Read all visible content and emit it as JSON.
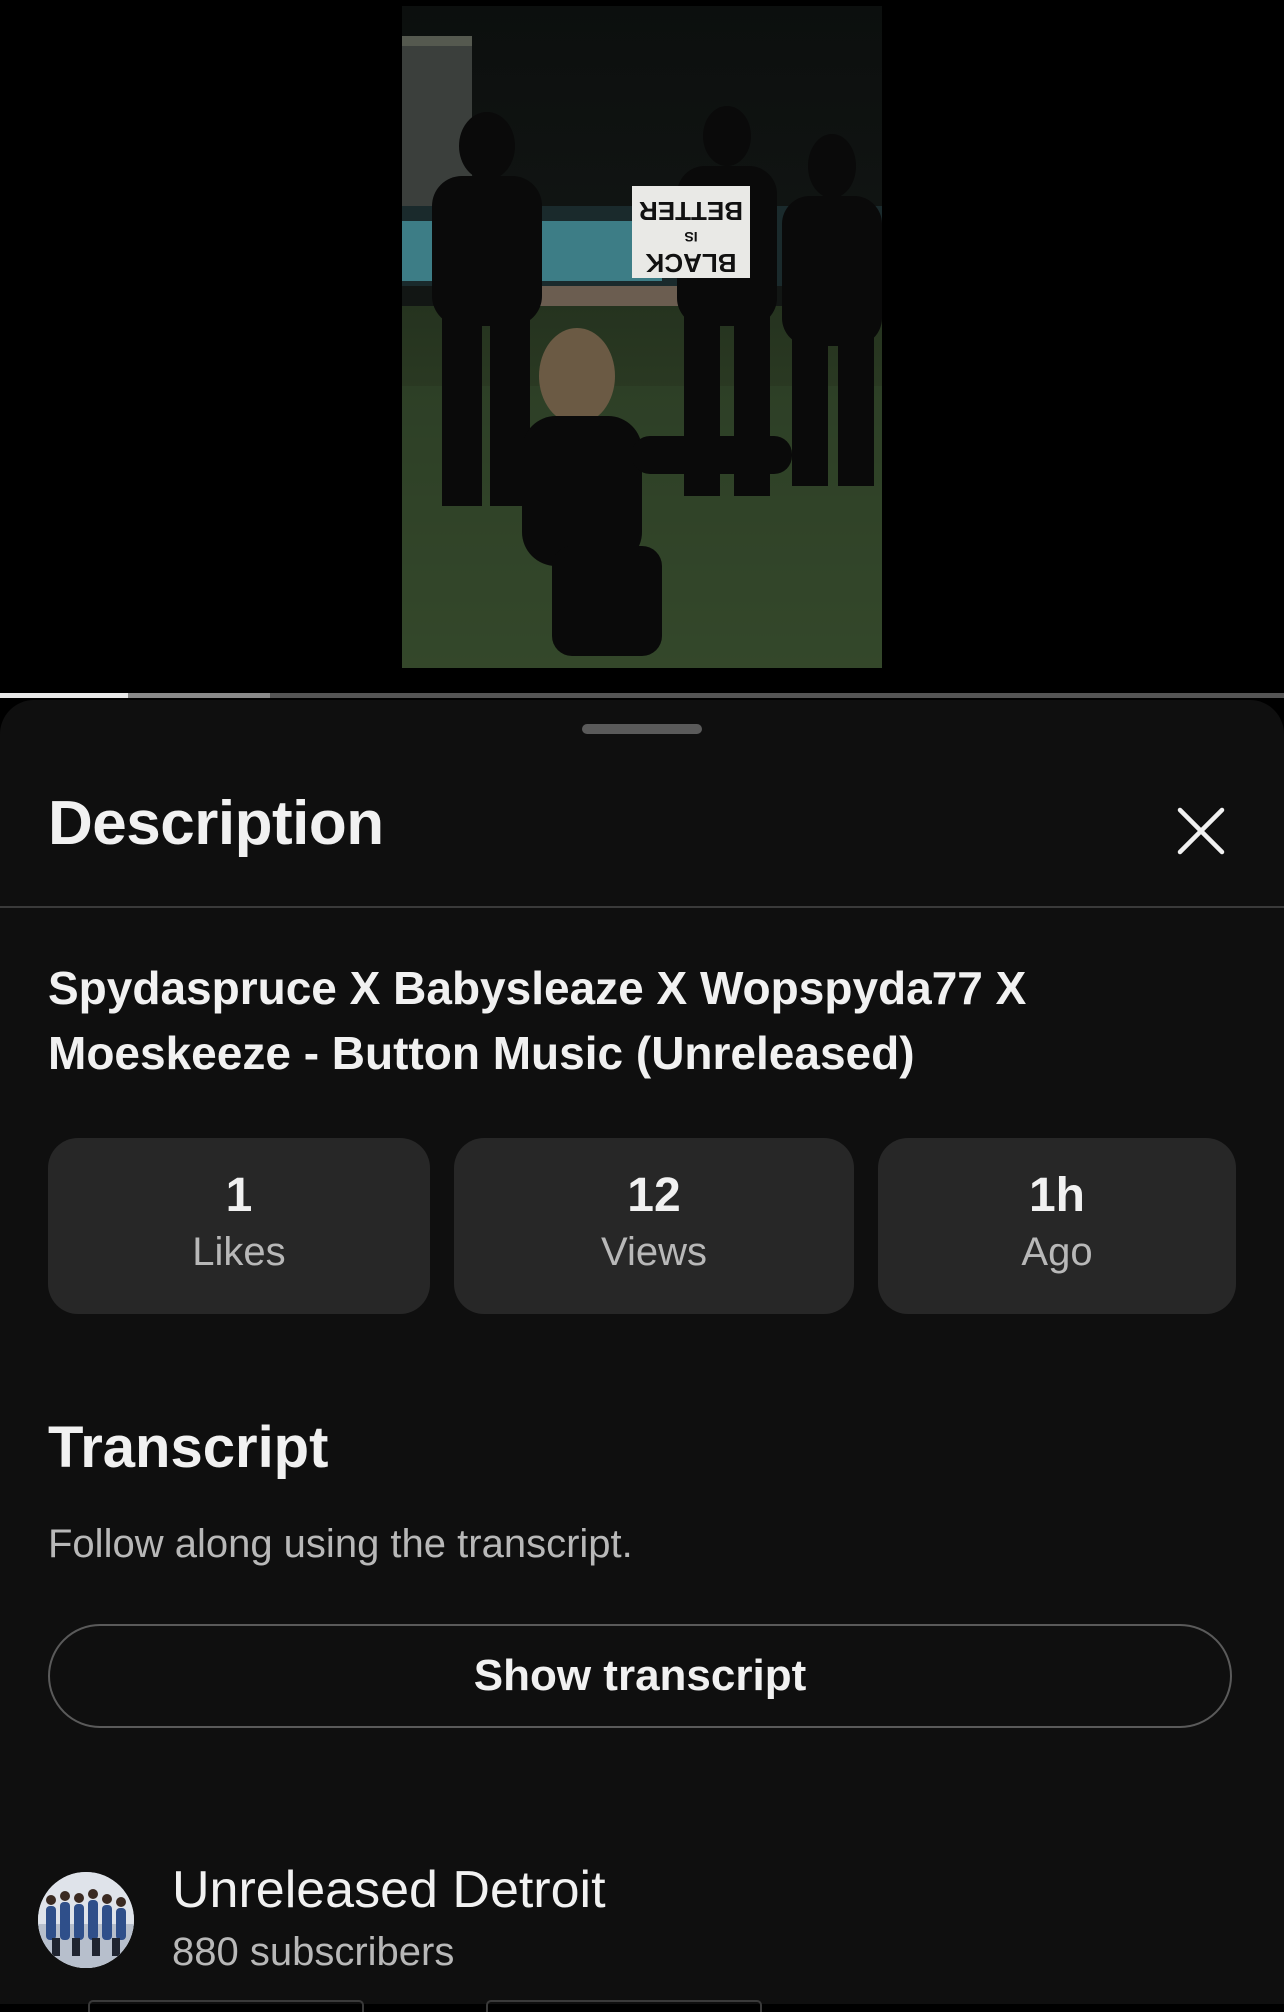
{
  "player": {
    "progress_played": 0.1,
    "progress_buffered": 0.21,
    "thumbnail_sign_text": [
      "BETTER",
      "IS",
      "BLACK"
    ]
  },
  "sheet": {
    "title": "Description",
    "close_icon": "close-icon"
  },
  "video": {
    "title": "Spydaspruce X Babysleaze X Wopspyda77 X Moeskeeze - Button Music (Unreleased)"
  },
  "stats": [
    {
      "value": "1",
      "label": "Likes"
    },
    {
      "value": "12",
      "label": "Views"
    },
    {
      "value": "1h",
      "label": "Ago"
    }
  ],
  "transcript": {
    "heading": "Transcript",
    "subtitle": "Follow along using the transcript.",
    "button_label": "Show transcript"
  },
  "channel": {
    "name": "Unreleased Detroit",
    "subscribers": "880 subscribers"
  },
  "colors": {
    "sheet_bg": "#0f0f0f",
    "card_bg": "#272727",
    "text_primary": "#f1f1f1",
    "text_secondary": "#b8b8b8"
  }
}
